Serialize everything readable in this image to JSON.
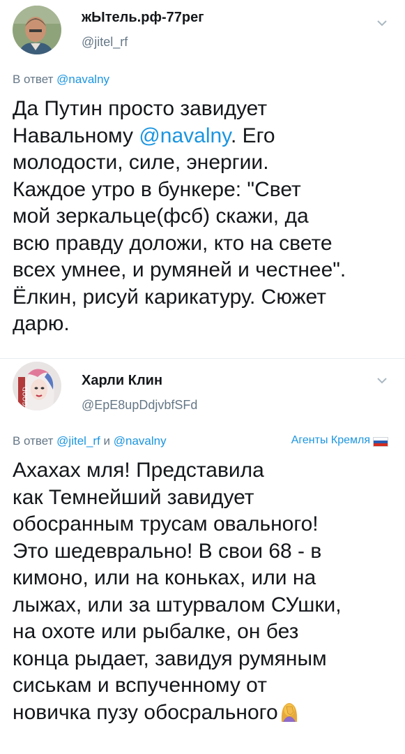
{
  "tweets": [
    {
      "author_name": "жЫтель.рф-77рег",
      "author_handle": "@jitel_rf",
      "reply_prefix": "В ответ ",
      "reply_mention": "@navalny",
      "body": {
        "l1": "Да Путин просто завидует",
        "l2_pre": "Навальному ",
        "l2_mention": "@navalny",
        "l2_post": ". Его",
        "l3": "молодости, силе, энергии.",
        "l4": "Каждое утро в бункере: \"Свет",
        "l5": "мой зеркальце(фсб) скажи, да",
        "l6": "всю правду доложи, кто на свете",
        "l7": "всех умнее, и румяней и честнее\".",
        "l8": "Ёлкин, рисуй карикатуру. Сюжет",
        "l9": "дарю."
      }
    },
    {
      "author_name": "Харли Клин",
      "author_handle": "@EpE8upDdjvbfSFd",
      "reply_prefix": "В ответ ",
      "reply_mention_1": "@jitel_rf",
      "reply_and": " и ",
      "reply_mention_2": "@navalny",
      "badge_text": "Агенты Кремля",
      "body": {
        "l1": "Ахахах мля! Представила",
        "l2": "как Темнейший завидует",
        "l3": "обосранным трусам овального!",
        "l4": "Это шедеврально! В свои 68 - в",
        "l5": "кимоно, или на коньках, или на",
        "l6": "лыжах, или за штурвалом СУшки,",
        "l7": "на охоте или рыбалке, он без",
        "l8": "конца рыдает, завидуя румяным",
        "l9": "сиськам и вспученному от",
        "l10": "новичка пузу обосрального"
      }
    }
  ],
  "icons": {
    "chevron": "chevron-down-icon",
    "flag": "russia-flag-icon",
    "emoji": "facepalm-woman-emoji-icon"
  },
  "colors": {
    "link": "#1b95e0",
    "secondary": "#657786",
    "text": "#14171a"
  }
}
